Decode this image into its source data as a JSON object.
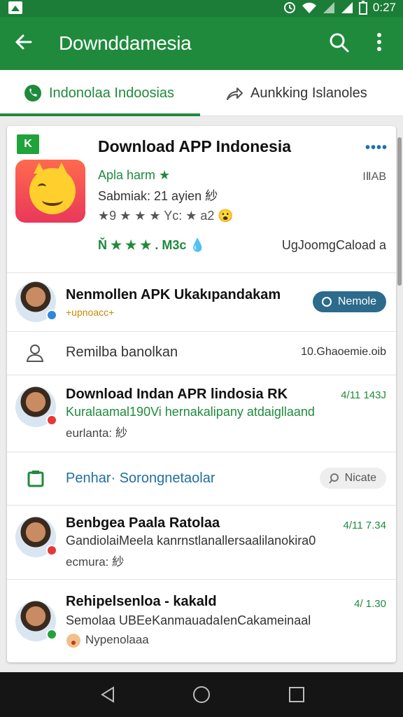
{
  "status": {
    "time": "0:27"
  },
  "app_bar": {
    "title": "Downddamesia"
  },
  "tabs": [
    {
      "label": "Indonolaa Indoosias"
    },
    {
      "label": "Aunkking Islanoles"
    }
  ],
  "hero": {
    "badge": "K",
    "title": "Download APP Indonesia",
    "more": "••••",
    "line1": "Apla harm ★",
    "line2": "Sabmiak: 21 ayien 紗",
    "line3": "★9 ★ ★ ★ Yc: ★ a2 😮",
    "line4": "Ň ★ ★ ★ . M3c 💧",
    "right1": "IⅡAB",
    "right2": "UgJoomgCaload a"
  },
  "rows": [
    {
      "name": "Nenmollen APK Ukakıpandakam",
      "sub": "+upnoacc+",
      "pill": "Nemole"
    },
    {
      "label": "Remilba banolkan",
      "right": "10.Ghaoemie.oib"
    },
    {
      "name": "Download Indan APR lindosia RK",
      "time": "4/11 143J",
      "sub": "Kuralaamal190Vi hernakalipany atdaigllaand",
      "sub2": "eurlanta: 紗"
    },
    {
      "label": "Penhar· Sorongnetaolar",
      "pill": "Nicate"
    },
    {
      "name": "Benbgea Paala Ratolaa",
      "time": "4/11 7.34",
      "sub": "GandiolaiMeela kanrnstlanallersaalilanokira0",
      "sub2": "ecmura: 紗"
    },
    {
      "name": "Rehipelsenloa - kakald",
      "time": "4/ 1.30",
      "sub": "Semolaa UBEeKanmauadaIenCakameinaal",
      "sub2": "Nypenolaaa"
    }
  ],
  "colors": {
    "primary": "#1f8a3c",
    "accent_blue": "#2c6b8c",
    "status_bar": "#1b7d37"
  }
}
